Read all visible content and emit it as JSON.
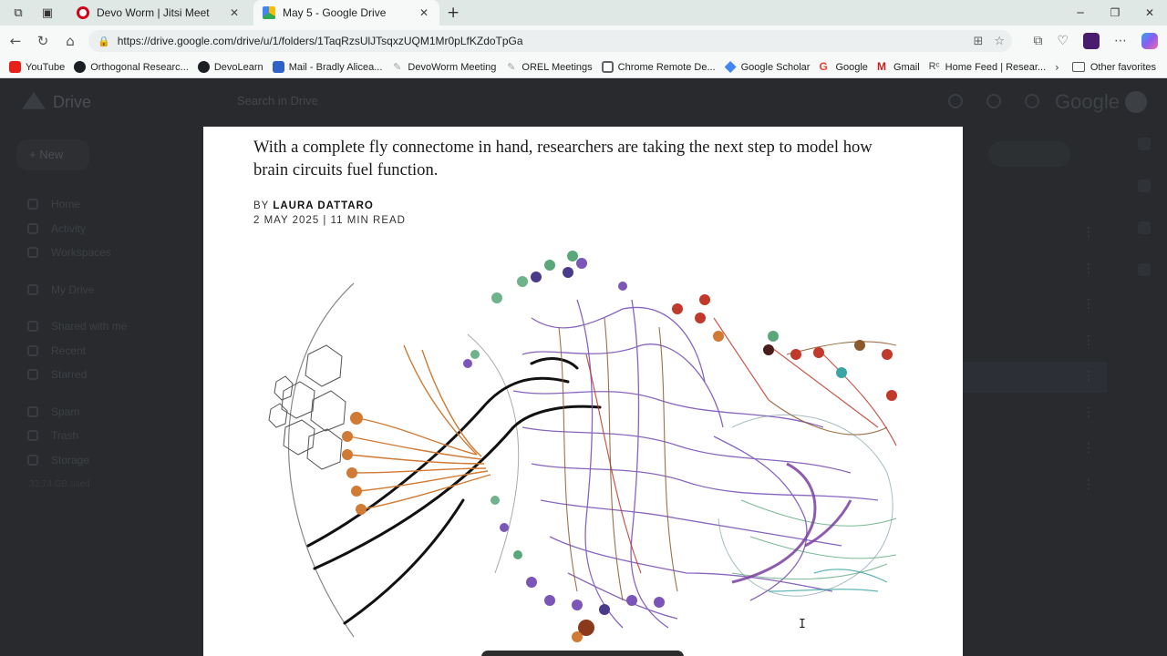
{
  "browser": {
    "tabs": [
      {
        "title": "Devo Worm | Jitsi Meet",
        "active": false
      },
      {
        "title": "May 5 - Google Drive",
        "active": true
      }
    ],
    "url": "https://drive.google.com/drive/u/1/folders/1TaqRzsUlJTsqxzUQM1Mr0pLfKZdoTpGa",
    "bookmarks": [
      {
        "label": "YouTube",
        "color": "#e62117"
      },
      {
        "label": "Orthogonal Researc...",
        "color": "#1b1f23"
      },
      {
        "label": "DevoLearn",
        "color": "#1b1f23"
      },
      {
        "label": "Mail - Bradly Alicea...",
        "color": "#2f62c8"
      },
      {
        "label": "DevoWorm Meeting",
        "color": "#9aa0a6"
      },
      {
        "label": "OREL Meetings",
        "color": "#9aa0a6"
      },
      {
        "label": "Chrome Remote De...",
        "color": "#5f6368"
      },
      {
        "label": "Google Scholar",
        "color": "#4285f4"
      },
      {
        "label": "Google",
        "color": "#ea4335"
      },
      {
        "label": "Gmail",
        "color": "#c5221f"
      },
      {
        "label": "Home Feed | Resear...",
        "color": "#444444"
      }
    ],
    "other_favorites": "Other favorites"
  },
  "drive": {
    "logo_text": "Drive",
    "search_placeholder": "Search in Drive",
    "google_word": "Google",
    "new_label": "New",
    "sidebar": [
      "Home",
      "Activity",
      "Workspaces",
      "My Drive",
      "Shared with me",
      "Recent",
      "Starred",
      "Spam",
      "Trash",
      "Storage"
    ],
    "storage_text": "33.74 GB used"
  },
  "article": {
    "subtitle": "With a complete fly connectome in hand, researchers are taking the next step to model how brain circuits fuel function.",
    "by_prefix": "BY",
    "author": "LAURA DATTARO",
    "dateline": "2 MAY 2025 | 11 MIN READ"
  }
}
